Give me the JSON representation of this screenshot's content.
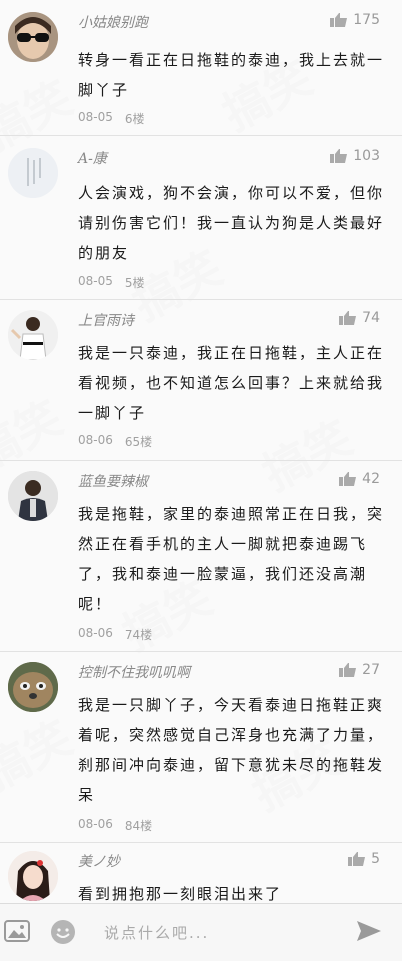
{
  "comments": [
    {
      "username": "小姑娘别跑",
      "likes": "175",
      "text": "转身一看正在日拖鞋的泰迪，我上去就一脚丫子",
      "date": "08-05",
      "floor": "6楼"
    },
    {
      "username": "A-康",
      "likes": "103",
      "text": "人会演戏，狗不会演，你可以不爱，但你请别伤害它们！我一直认为狗是人类最好的朋友",
      "date": "08-05",
      "floor": "5楼"
    },
    {
      "username": "上官雨诗",
      "likes": "74",
      "text": "我是一只泰迪，我正在日拖鞋，主人正在看视频，也不知道怎么回事？上来就给我一脚丫子",
      "date": "08-06",
      "floor": "65楼"
    },
    {
      "username": "蓝鱼要辣椒",
      "likes": "42",
      "text": "我是拖鞋，家里的泰迪照常正在日我，突然正在看手机的主人一脚就把泰迪踢飞了，我和泰迪一脸蒙逼，我们还没高潮呢！",
      "date": "08-06",
      "floor": "74楼"
    },
    {
      "username": "控制不住我叽叽啊",
      "likes": "27",
      "text": "我是一只脚丫子，今天看泰迪日拖鞋正爽着呢，突然感觉自己浑身也充满了力量，刹那间冲向泰迪，留下意犹未尽的拖鞋发呆",
      "date": "08-06",
      "floor": "84楼"
    },
    {
      "username": "美ノ妙",
      "likes": "5",
      "text": "看到拥抱那一刻眼泪出来了",
      "date": "",
      "floor": ""
    }
  ],
  "input": {
    "placeholder": "说点什么吧..."
  },
  "icons": {
    "like": "thumbs-up-icon",
    "image": "image-icon",
    "emoji": "emoji-icon",
    "send": "send-icon"
  }
}
